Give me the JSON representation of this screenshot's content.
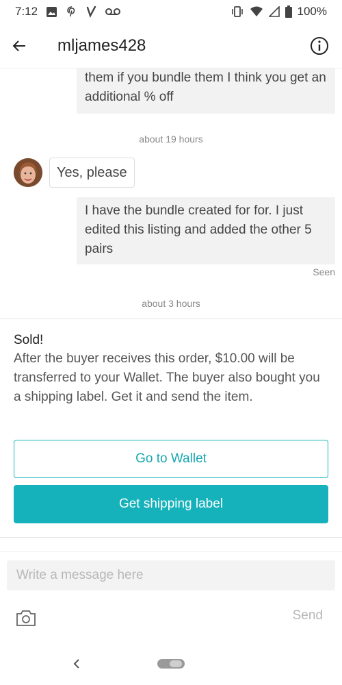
{
  "status_bar": {
    "time": "7:12",
    "battery": "100%",
    "left_icons": [
      "image-icon",
      "pinterest-icon",
      "vinted-icon",
      "voicemail-icon"
    ],
    "right_icons": [
      "vibrate-icon",
      "wifi-icon",
      "signal-icon",
      "battery-icon"
    ]
  },
  "header": {
    "title": "mljames428",
    "back_icon": "arrow-left-icon",
    "info_icon": "info-icon"
  },
  "messages": {
    "outgoing_1": "them if you bundle them I think you get an additional % off",
    "timestamp_1": "about 19 hours",
    "incoming_1": "Yes, please",
    "outgoing_2": "I have the bundle created for for. I just edited this listing and added the other 5 pairs",
    "seen": "Seen",
    "timestamp_2": "about 3 hours"
  },
  "sold_panel": {
    "title": "Sold!",
    "body": "After the buyer receives this order, $10.00 will be transferred to your Wallet. The buyer also bought you a shipping label. Get it and send the item.",
    "wallet_button": "Go to Wallet",
    "shipping_button": "Get shipping label"
  },
  "composer": {
    "placeholder": "Write a message here",
    "send_label": "Send",
    "camera_icon": "camera-icon"
  },
  "colors": {
    "accent": "#15b2bb",
    "bubble_out": "#f2f2f2",
    "muted_text": "#888888"
  }
}
